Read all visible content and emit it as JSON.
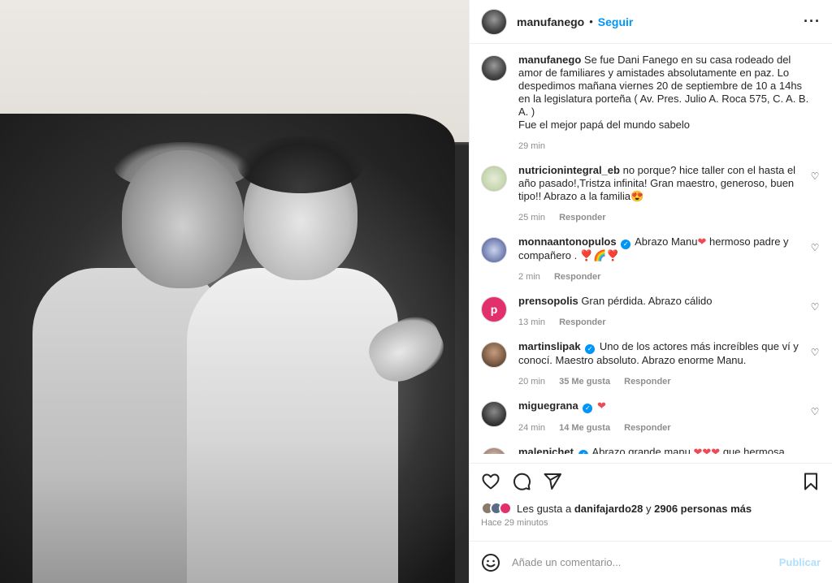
{
  "header": {
    "username": "manufanego",
    "dot": "•",
    "follow_label": "Seguir",
    "more_icon": "more-horizontal-icon"
  },
  "caption": {
    "username": "manufanego",
    "text": "Se fue Dani Fanego en su casa rodeado del amor de familiares y amistades absolutamente en paz. Lo despedimos mañana viernes 20 de septiembre de 10 a 14hs en la legislatura porteña ( Av. Pres. Julio A. Roca 575, C. A. B. A. )",
    "text2": "Fue el mejor papá del mundo sabelo",
    "time": "29 min"
  },
  "comments": [
    {
      "username": "nutricionintegral_eb",
      "text": "no porque? hice taller con el hasta el año pasado!,Tristza infinita! Gran maestro, generoso, buen tipo!! Abrazo a la familia😍",
      "time": "25 min",
      "reply": "Responder"
    },
    {
      "username": "monnaantonopulos",
      "text": "Abrazo Manu",
      "text_b": "hermoso padre y compañero .",
      "emoji": "❣️🌈❣️",
      "time": "2 min",
      "reply": "Responder"
    },
    {
      "username": "prensopolis",
      "text": "Gran pérdida. Abrazo cálido",
      "time": "13 min",
      "reply": "Responder"
    },
    {
      "username": "martinslipak",
      "text": "Uno de los actores más increíbles que ví y conocí. Maestro absoluto. Abrazo enorme Manu.",
      "time": "20 min",
      "likes": "35 Me gusta",
      "reply": "Responder"
    },
    {
      "username": "miguegrana",
      "text": "",
      "time": "24 min",
      "likes": "14 Me gusta",
      "reply": "Responder"
    },
    {
      "username": "malenichet",
      "text": "Abrazo grande manu",
      "text_b": "que hermosa"
    }
  ],
  "actions": {
    "like_icon": "heart-icon",
    "comment_icon": "comment-icon",
    "share_icon": "send-icon",
    "save_icon": "bookmark-icon"
  },
  "likes": {
    "prefix": "Les gusta a",
    "user": "danifajardo28",
    "conj": "y",
    "count": "2906 personas más"
  },
  "posted": "Hace 29 minutos",
  "add_comment": {
    "placeholder": "Añade un comentario...",
    "publish_label": "Publicar",
    "emoji_icon": "smiley-icon"
  },
  "colors": {
    "accent": "#0095f6",
    "heart_red": "#ed4956",
    "muted": "#8e8e8e"
  }
}
